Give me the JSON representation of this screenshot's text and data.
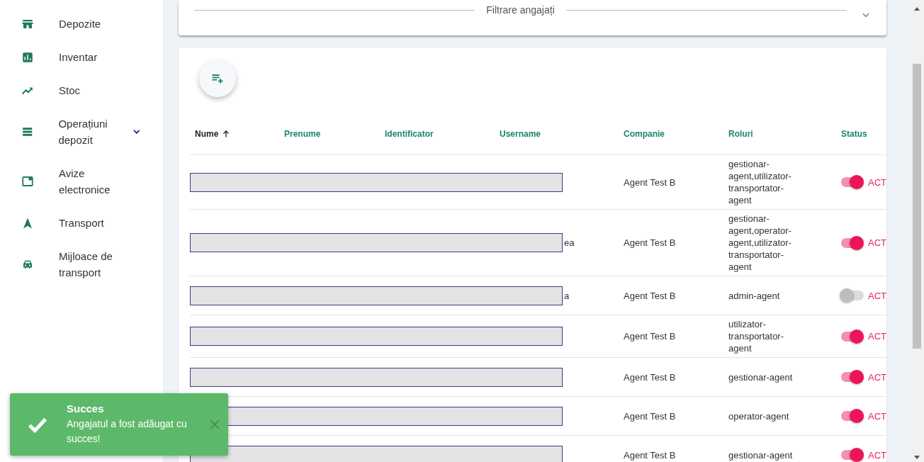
{
  "sidebar": {
    "items": [
      {
        "label": "Depozite",
        "expandable": false
      },
      {
        "label": "Inventar",
        "expandable": false
      },
      {
        "label": "Stoc",
        "expandable": false
      },
      {
        "label": "Operațiuni depozit",
        "expandable": true
      },
      {
        "label": "Avize electronice",
        "expandable": false
      },
      {
        "label": "Transport",
        "expandable": false
      },
      {
        "label": "Mijloace de transport",
        "expandable": false
      }
    ]
  },
  "filter": {
    "title": "Filtrare angajați",
    "expanded": false
  },
  "table": {
    "columns": [
      {
        "label": "Nume",
        "sorted": true
      },
      {
        "label": "Prenume",
        "sorted": false
      },
      {
        "label": "Identificator",
        "sorted": false
      },
      {
        "label": "Username",
        "sorted": false
      },
      {
        "label": "Companie",
        "sorted": false
      },
      {
        "label": "Roluri",
        "sorted": false
      },
      {
        "label": "Status",
        "sorted": false
      }
    ],
    "rows": [
      {
        "redacted": true,
        "company": "Agent Test B",
        "roles": "gestionar-agent,utilizator-transportator-agent",
        "active": true,
        "status": "ACT"
      },
      {
        "redacted": true,
        "username_tail": "ea",
        "company": "Agent Test B",
        "roles": "gestionar-agent,operator-agent,utilizator-transportator-agent",
        "active": true,
        "status": "ACT"
      },
      {
        "redacted": true,
        "username_tail": "a",
        "company": "Agent Test B",
        "roles": "admin-agent",
        "active": false,
        "status": "ACT"
      },
      {
        "redacted": true,
        "company": "Agent Test B",
        "roles": "utilizator-transportator-agent",
        "active": true,
        "status": "ACT"
      },
      {
        "redacted": true,
        "company": "Agent Test B",
        "roles": "gestionar-agent",
        "active": true,
        "status": "ACT"
      },
      {
        "redacted": true,
        "company": "Agent Test B",
        "roles": "operator-agent",
        "active": true,
        "status": "ACT"
      },
      {
        "redacted": true,
        "company": "Agent Test B",
        "roles": "gestionar-agent",
        "active": true,
        "status": "ACT"
      }
    ]
  },
  "toast": {
    "title": "Succes",
    "message": "Angajatul a fost adăugat cu succes!"
  }
}
